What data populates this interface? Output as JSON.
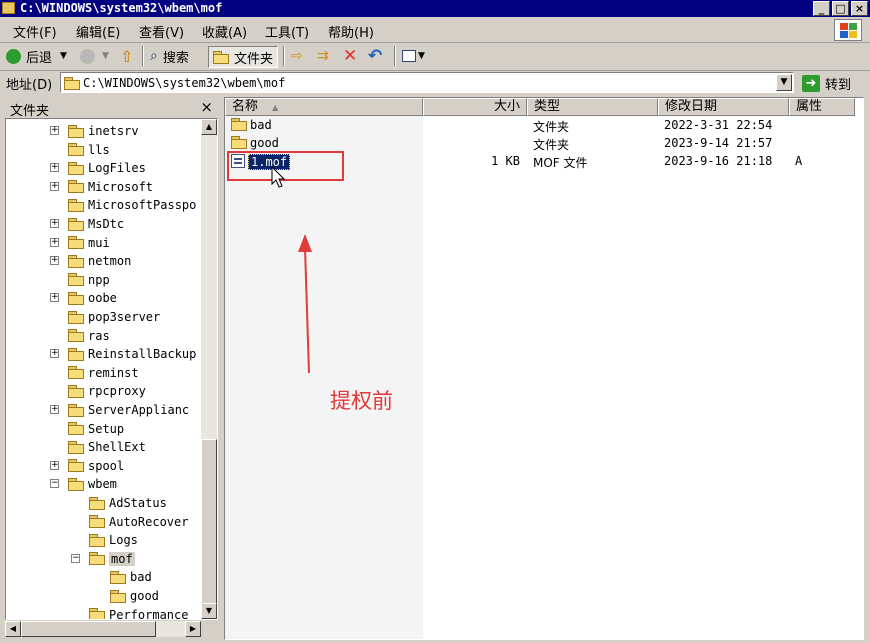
{
  "window": {
    "title": "C:\\WINDOWS\\system32\\wbem\\mof",
    "minimize": "_",
    "maximize": "□",
    "close": "×"
  },
  "menu": [
    "文件(F)",
    "编辑(E)",
    "查看(V)",
    "收藏(A)",
    "工具(T)",
    "帮助(H)"
  ],
  "toolbar": {
    "back": "后退",
    "search": "搜索",
    "folders": "文件夹"
  },
  "address": {
    "label": "地址(D)",
    "value": "C:\\WINDOWS\\system32\\wbem\\mof",
    "go": "转到"
  },
  "folder_pane": {
    "title": "文件夹",
    "close": "×",
    "items": [
      {
        "label": "inetsrv",
        "expand": "+"
      },
      {
        "label": "lls",
        "expand": ""
      },
      {
        "label": "LogFiles",
        "expand": "+"
      },
      {
        "label": "Microsoft",
        "expand": "+"
      },
      {
        "label": "MicrosoftPasspo",
        "expand": ""
      },
      {
        "label": "MsDtc",
        "expand": "+"
      },
      {
        "label": "mui",
        "expand": "+"
      },
      {
        "label": "netmon",
        "expand": "+"
      },
      {
        "label": "npp",
        "expand": ""
      },
      {
        "label": "oobe",
        "expand": "+"
      },
      {
        "label": "pop3server",
        "expand": ""
      },
      {
        "label": "ras",
        "expand": ""
      },
      {
        "label": "ReinstallBackup",
        "expand": "+"
      },
      {
        "label": "reminst",
        "expand": ""
      },
      {
        "label": "rpcproxy",
        "expand": ""
      },
      {
        "label": "ServerApplianc",
        "expand": "+"
      },
      {
        "label": "Setup",
        "expand": ""
      },
      {
        "label": "ShellExt",
        "expand": ""
      },
      {
        "label": "spool",
        "expand": "+"
      },
      {
        "label": "wbem",
        "expand": "−"
      },
      {
        "label": "AdStatus",
        "expand": ""
      },
      {
        "label": "AutoRecover",
        "expand": ""
      },
      {
        "label": "Logs",
        "expand": ""
      },
      {
        "label": "mof",
        "expand": "−"
      },
      {
        "label": "bad",
        "expand": ""
      },
      {
        "label": "good",
        "expand": ""
      },
      {
        "label": "Performance",
        "expand": ""
      }
    ]
  },
  "columns": {
    "name": "名称",
    "size": "大小",
    "type": "类型",
    "modified": "修改日期",
    "attrs": "属性"
  },
  "files": [
    {
      "name": "bad",
      "size": "",
      "type": "文件夹",
      "modified": "2022-3-31 22:54",
      "attrs": ""
    },
    {
      "name": "good",
      "size": "",
      "type": "文件夹",
      "modified": "2023-9-14 21:57",
      "attrs": ""
    },
    {
      "name": "1.mof",
      "size": "1 KB",
      "type": "MOF 文件",
      "modified": "2023-9-16 21:18",
      "attrs": "A"
    }
  ],
  "annotation": {
    "text": "提权前",
    "color": "#e03a3a"
  }
}
